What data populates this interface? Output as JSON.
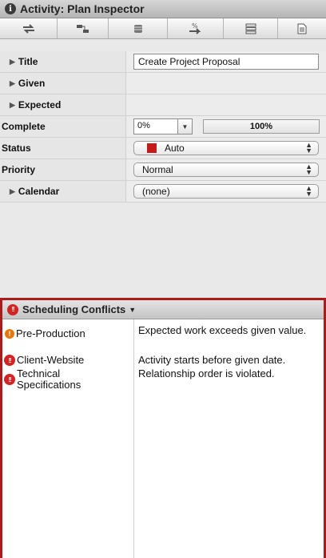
{
  "inspector": {
    "title": "Activity: Plan Inspector",
    "toolbar_icons": [
      "swap-arrows-icon",
      "resize-corner-icon",
      "database-icon",
      "percent-arrow-icon",
      "list-icon",
      "document-icon"
    ],
    "rows": {
      "title": {
        "label": "Title",
        "value": "Create Project Proposal"
      },
      "given": {
        "label": "Given"
      },
      "expected": {
        "label": "Expected"
      },
      "complete": {
        "label": "Complete",
        "value": "0%",
        "progress_label": "100%"
      },
      "status": {
        "label": "Status",
        "value": "Auto",
        "swatch_color": "#c41a1a"
      },
      "priority": {
        "label": "Priority",
        "value": "Normal"
      },
      "calendar": {
        "label": "Calendar",
        "value": "(none)"
      }
    }
  },
  "conflicts": {
    "title": "Scheduling Conflicts",
    "accent_color": "#ab1b1b",
    "items": [
      {
        "name": "Pre-Production",
        "severity": "warning",
        "message": "Expected work exceeds given value."
      },
      {
        "name": "Client-Website",
        "severity": "error",
        "message": "Activity starts before given date."
      },
      {
        "name": "Technical Specifications",
        "severity": "error",
        "message": "Relationship order is violated."
      }
    ]
  }
}
